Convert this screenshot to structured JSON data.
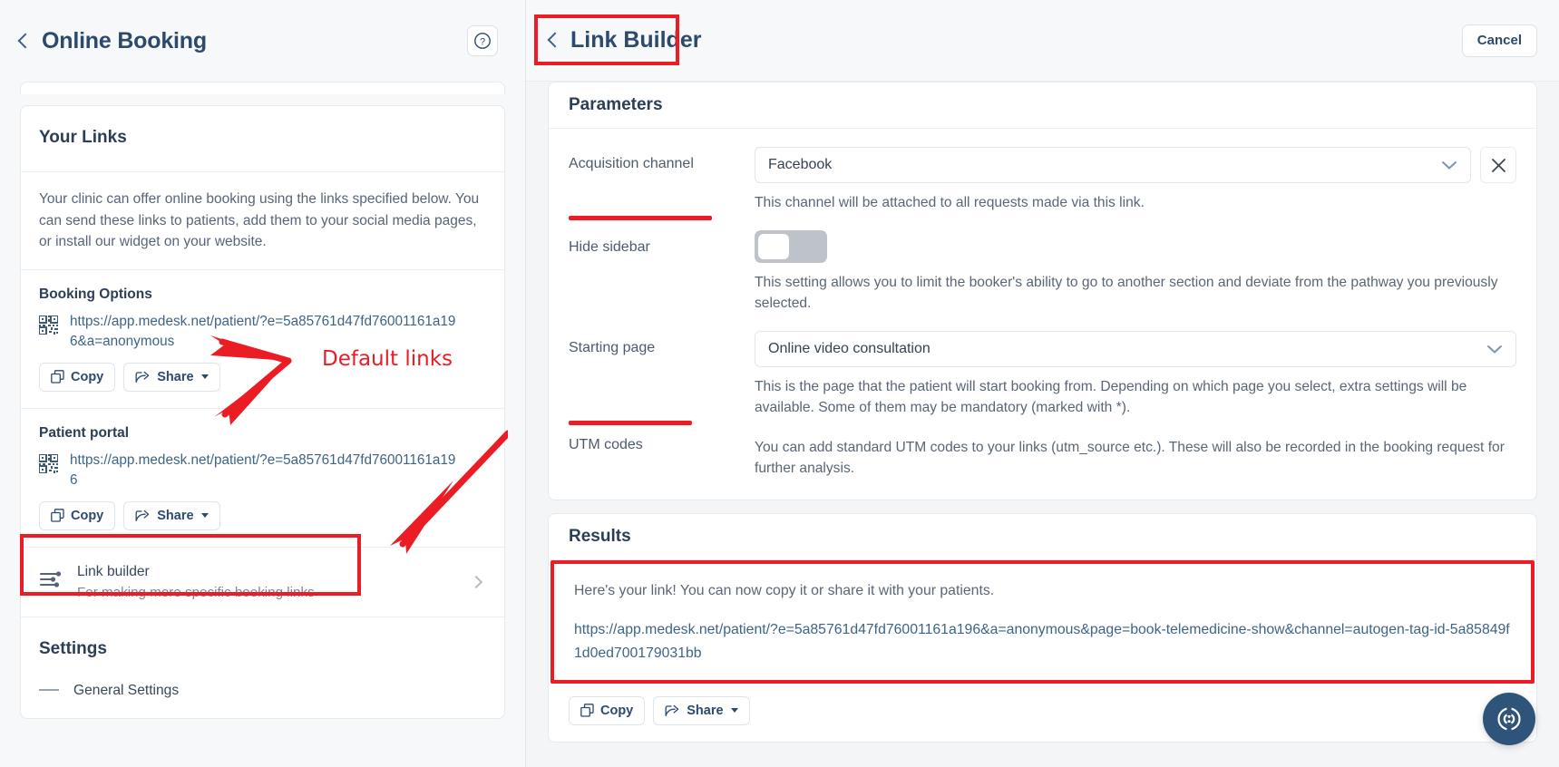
{
  "left": {
    "header": {
      "title": "Online Booking",
      "back_icon": "chevron-left-icon",
      "help_icon": "question-circle-icon"
    },
    "your_links": {
      "title": "Your Links",
      "description": "Your clinic can offer online booking using the links specified below. You can send these links to patients, add them to your social media pages, or install our widget on your website."
    },
    "booking_options": {
      "title": "Booking Options",
      "url": "https://app.medesk.net/patient/?e=5a85761d47fd76001161a196&a=anonymous",
      "qr_icon": "qr-code-icon",
      "copy_label": "Copy",
      "share_label": "Share",
      "copy_icon": "copy-icon",
      "share_icon": "share-icon"
    },
    "patient_portal": {
      "title": "Patient portal",
      "url": "https://app.medesk.net/patient/?e=5a85761d47fd76001161a196",
      "qr_icon": "qr-code-icon",
      "copy_label": "Copy",
      "share_label": "Share"
    },
    "link_builder_row": {
      "icon": "sliders-icon",
      "title": "Link builder",
      "subtitle": "For making more specific booking links",
      "chevron": "chevron-right-icon"
    },
    "settings": {
      "title": "Settings",
      "first_item": "General Settings"
    }
  },
  "right": {
    "header": {
      "title": "Link Builder",
      "back_icon": "chevron-left-icon",
      "cancel_label": "Cancel"
    },
    "parameters": {
      "title": "Parameters",
      "acquisition_channel": {
        "label": "Acquisition channel",
        "value": "Facebook",
        "help": "This channel will be attached to all requests made via this link.",
        "chevron_icon": "chevron-down-icon",
        "clear_icon": "close-icon"
      },
      "hide_sidebar": {
        "label": "Hide sidebar",
        "state": "off",
        "help": "This setting allows you to limit the booker's ability to go to another section and deviate from the pathway you previously selected."
      },
      "starting_page": {
        "label": "Starting page",
        "value": "Online video consultation",
        "help": "This is the page that the patient will start booking from. Depending on which page you select, extra settings will be available. Some of them may be mandatory (marked with *).",
        "chevron_icon": "chevron-down-icon"
      },
      "utm_codes": {
        "label": "UTM codes",
        "help": "You can add standard UTM codes to your links (utm_source etc.). These will also be recorded in the booking request for further analysis."
      }
    },
    "results": {
      "title": "Results",
      "intro": "Here's your link! You can now copy it or share it with your patients.",
      "url": "https://app.medesk.net/patient/?e=5a85761d47fd76001161a196&a=anonymous&page=book-telemedicine-show&channel=autogen-tag-id-5a85849f1d0ed700179031bb",
      "copy_label": "Copy",
      "share_label": "Share"
    },
    "help_bubble_icon": "help-circle-icon"
  },
  "annotations": {
    "default_links_label": "Default links",
    "accent_red": "#ec1c24"
  }
}
